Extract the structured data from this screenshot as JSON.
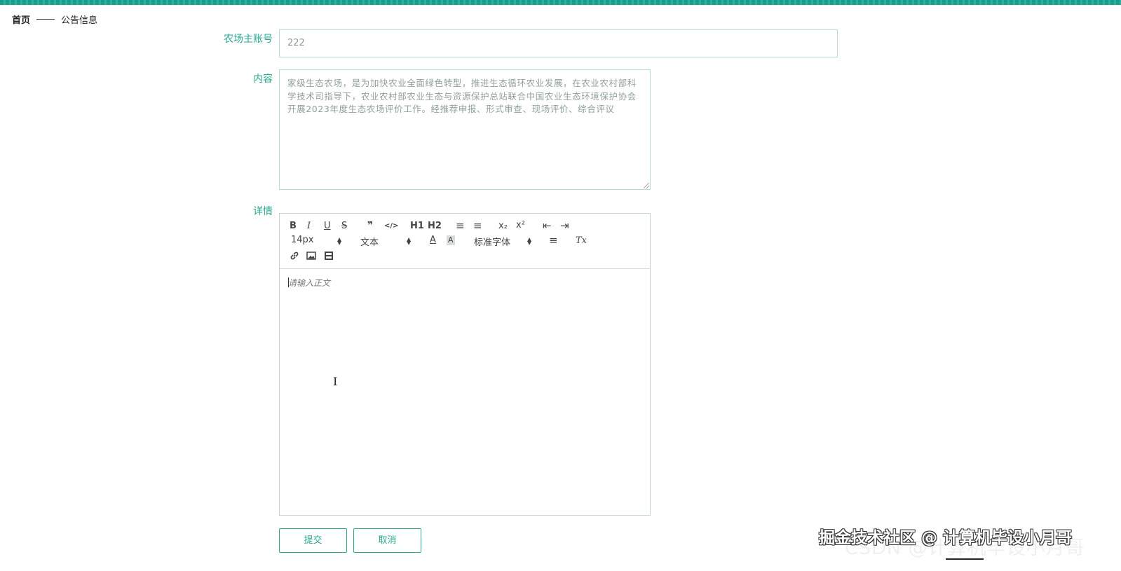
{
  "breadcrumb": {
    "home": "首页",
    "current": "公告信息"
  },
  "fields": {
    "account": {
      "label": "农场主账号",
      "value": "222"
    },
    "content": {
      "label": "内容",
      "value": "家级生态农场，是为加快农业全面绿色转型，推进生态循环农业发展，在农业农村部科学技术司指导下，农业农村部农业生态与资源保护总站联合中国农业生态环境保护协会开展2023年度生态农场评价工作。经推荐申报、形式审查、现场评价、综合评议"
    },
    "detail": {
      "label": "详情"
    }
  },
  "editor": {
    "toolbar": {
      "bold": "B",
      "italic": "I",
      "underline": "U",
      "strike": "S",
      "quote": "❞",
      "code": "</>",
      "h1": "H1",
      "h2": "H2",
      "ordered_list": "≡",
      "bullet_list": "≡",
      "sub": "x₂",
      "sup": "x²",
      "outdent": "⇤",
      "indent": "⇥",
      "size": "14px",
      "header": "文本",
      "color": "A",
      "background": "A",
      "font": "标准字体",
      "align": "≡",
      "clean": "Tx"
    },
    "placeholder": "请输入正文"
  },
  "buttons": {
    "submit": "提交",
    "cancel": "取消"
  },
  "watermark": {
    "primary": "掘金技术社区 @ 计算机毕设小月哥",
    "secondary": "CSDN @计算机毕设小月哥"
  },
  "colors": {
    "accent": "#2aa891",
    "topbar": "#1a9e8a",
    "field_border": "#b9ddd6"
  }
}
